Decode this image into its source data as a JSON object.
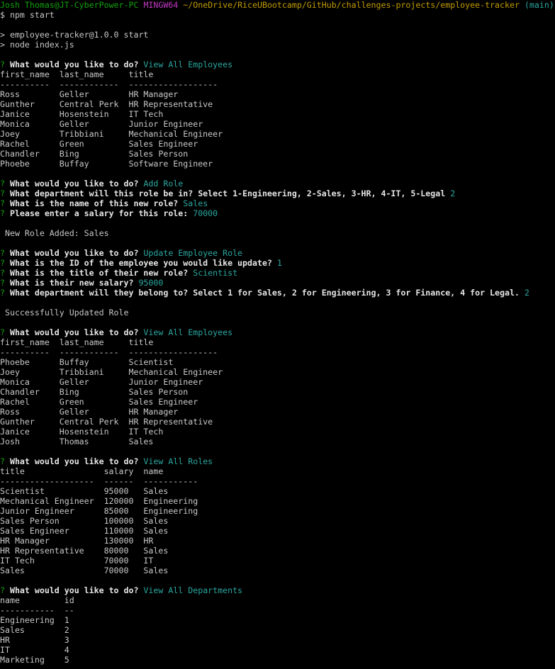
{
  "colors": {
    "background": "#000000",
    "text": "#c8c8c8",
    "prompt_user": "#13a10e",
    "prompt_shell": "#c239c2",
    "prompt_path": "#c19c00",
    "branch": "#2aa7a0",
    "answer": "#2aa7a0",
    "question_mark": "#13a10e"
  },
  "lines": [
    {
      "segs": [
        {
          "t": "Josh Thomas@JT-CyberPower-PC",
          "c": "green"
        },
        {
          "t": " "
        },
        {
          "t": "MINGW64",
          "c": "magenta"
        },
        {
          "t": " "
        },
        {
          "t": "~/OneDrive/RiceUBootcamp/GitHub/challenges-projects/employee-tracker",
          "c": "yellow"
        },
        {
          "t": " "
        },
        {
          "t": "(main)",
          "c": "cyan"
        }
      ]
    },
    {
      "segs": [
        {
          "t": "$ npm start"
        }
      ]
    },
    {
      "segs": []
    },
    {
      "segs": [
        {
          "t": "> employee-tracker@1.0.0 start"
        }
      ]
    },
    {
      "segs": [
        {
          "t": "> node index.js"
        }
      ]
    },
    {
      "segs": []
    },
    {
      "segs": [
        {
          "t": "?",
          "c": "green"
        },
        {
          "t": " What would you like to do?",
          "c": "white bold"
        },
        {
          "t": " View All Employees",
          "c": "cyan"
        }
      ]
    },
    {
      "segs": [
        {
          "t": "first_name  last_name     title"
        }
      ]
    },
    {
      "segs": [
        {
          "t": "----------  ------------  ------------------"
        }
      ]
    },
    {
      "segs": [
        {
          "t": "Ross        Geller        HR Manager"
        }
      ]
    },
    {
      "segs": [
        {
          "t": "Gunther     Central Perk  HR Representative"
        }
      ]
    },
    {
      "segs": [
        {
          "t": "Janice      Hosenstein    IT Tech"
        }
      ]
    },
    {
      "segs": [
        {
          "t": "Monica      Geller        Junior Engineer"
        }
      ]
    },
    {
      "segs": [
        {
          "t": "Joey        Tribbiani     Mechanical Engineer"
        }
      ]
    },
    {
      "segs": [
        {
          "t": "Rachel      Green         Sales Engineer"
        }
      ]
    },
    {
      "segs": [
        {
          "t": "Chandler    Bing          Sales Person"
        }
      ]
    },
    {
      "segs": [
        {
          "t": "Phoebe      Buffay        Software Engineer"
        }
      ]
    },
    {
      "segs": []
    },
    {
      "segs": [
        {
          "t": "?",
          "c": "green"
        },
        {
          "t": " What would you like to do?",
          "c": "white bold"
        },
        {
          "t": " Add Role",
          "c": "cyan"
        }
      ]
    },
    {
      "segs": [
        {
          "t": "?",
          "c": "green"
        },
        {
          "t": " What department will this role be in? Select 1-Engineering, 2-Sales, 3-HR, 4-IT, 5-Legal",
          "c": "white bold"
        },
        {
          "t": " 2",
          "c": "cyan"
        }
      ]
    },
    {
      "segs": [
        {
          "t": "?",
          "c": "green"
        },
        {
          "t": " What is the name of this new role?",
          "c": "white bold"
        },
        {
          "t": " Sales",
          "c": "cyan"
        }
      ]
    },
    {
      "segs": [
        {
          "t": "?",
          "c": "green"
        },
        {
          "t": " Please enter a salary for this role:",
          "c": "white bold"
        },
        {
          "t": " 70000",
          "c": "cyan"
        }
      ]
    },
    {
      "segs": []
    },
    {
      "segs": [
        {
          "t": " New Role Added: Sales"
        }
      ]
    },
    {
      "segs": []
    },
    {
      "segs": [
        {
          "t": "?",
          "c": "green"
        },
        {
          "t": " What would you like to do?",
          "c": "white bold"
        },
        {
          "t": " Update Employee Role",
          "c": "cyan"
        }
      ]
    },
    {
      "segs": [
        {
          "t": "?",
          "c": "green"
        },
        {
          "t": " What is the ID of the employee you would like update?",
          "c": "white bold"
        },
        {
          "t": " 1",
          "c": "cyan"
        }
      ]
    },
    {
      "segs": [
        {
          "t": "?",
          "c": "green"
        },
        {
          "t": " What is the title of their new role?",
          "c": "white bold"
        },
        {
          "t": " Scientist",
          "c": "cyan"
        }
      ]
    },
    {
      "segs": [
        {
          "t": "?",
          "c": "green"
        },
        {
          "t": " What is their new salary?",
          "c": "white bold"
        },
        {
          "t": " 95000",
          "c": "cyan"
        }
      ]
    },
    {
      "segs": [
        {
          "t": "?",
          "c": "green"
        },
        {
          "t": " What department will they belong to? Select 1 for Sales, 2 for Engineering, 3 for Finance, 4 for Legal.",
          "c": "white bold"
        },
        {
          "t": " 2",
          "c": "cyan"
        }
      ]
    },
    {
      "segs": []
    },
    {
      "segs": [
        {
          "t": " Successfully Updated Role"
        }
      ]
    },
    {
      "segs": []
    },
    {
      "segs": [
        {
          "t": "?",
          "c": "green"
        },
        {
          "t": " What would you like to do?",
          "c": "white bold"
        },
        {
          "t": " View All Employees",
          "c": "cyan"
        }
      ]
    },
    {
      "segs": [
        {
          "t": "first_name  last_name     title"
        }
      ]
    },
    {
      "segs": [
        {
          "t": "----------  ------------  ------------------"
        }
      ]
    },
    {
      "segs": [
        {
          "t": "Phoebe      Buffay        Scientist"
        }
      ]
    },
    {
      "segs": [
        {
          "t": "Joey        Tribbiani     Mechanical Engineer"
        }
      ]
    },
    {
      "segs": [
        {
          "t": "Monica      Geller        Junior Engineer"
        }
      ]
    },
    {
      "segs": [
        {
          "t": "Chandler    Bing          Sales Person"
        }
      ]
    },
    {
      "segs": [
        {
          "t": "Rachel      Green         Sales Engineer"
        }
      ]
    },
    {
      "segs": [
        {
          "t": "Ross        Geller        HR Manager"
        }
      ]
    },
    {
      "segs": [
        {
          "t": "Gunther     Central Perk  HR Representative"
        }
      ]
    },
    {
      "segs": [
        {
          "t": "Janice      Hosenstein    IT Tech"
        }
      ]
    },
    {
      "segs": [
        {
          "t": "Josh        Thomas        Sales"
        }
      ]
    },
    {
      "segs": []
    },
    {
      "segs": [
        {
          "t": "?",
          "c": "green"
        },
        {
          "t": " What would you like to do?",
          "c": "white bold"
        },
        {
          "t": " View All Roles",
          "c": "cyan"
        }
      ]
    },
    {
      "segs": [
        {
          "t": "title                salary  name"
        }
      ]
    },
    {
      "segs": [
        {
          "t": "-------------------  ------  -----------"
        }
      ]
    },
    {
      "segs": [
        {
          "t": "Scientist            95000   Sales"
        }
      ]
    },
    {
      "segs": [
        {
          "t": "Mechanical Engineer  120000  Engineering"
        }
      ]
    },
    {
      "segs": [
        {
          "t": "Junior Engineer      85000   Engineering"
        }
      ]
    },
    {
      "segs": [
        {
          "t": "Sales Person         100000  Sales"
        }
      ]
    },
    {
      "segs": [
        {
          "t": "Sales Engineer       110000  Sales"
        }
      ]
    },
    {
      "segs": [
        {
          "t": "HR Manager           130000  HR"
        }
      ]
    },
    {
      "segs": [
        {
          "t": "HR Representative    80000   Sales"
        }
      ]
    },
    {
      "segs": [
        {
          "t": "IT Tech              70000   IT"
        }
      ]
    },
    {
      "segs": [
        {
          "t": "Sales                70000   Sales"
        }
      ]
    },
    {
      "segs": []
    },
    {
      "segs": [
        {
          "t": "?",
          "c": "green"
        },
        {
          "t": " What would you like to do?",
          "c": "white bold"
        },
        {
          "t": " View All Departments",
          "c": "cyan"
        }
      ]
    },
    {
      "segs": [
        {
          "t": "name         id"
        }
      ]
    },
    {
      "segs": [
        {
          "t": "-----------  --"
        }
      ]
    },
    {
      "segs": [
        {
          "t": "Engineering  1"
        }
      ]
    },
    {
      "segs": [
        {
          "t": "Sales        2"
        }
      ]
    },
    {
      "segs": [
        {
          "t": "HR           3"
        }
      ]
    },
    {
      "segs": [
        {
          "t": "IT           4"
        }
      ]
    },
    {
      "segs": [
        {
          "t": "Marketing    5"
        }
      ]
    }
  ]
}
